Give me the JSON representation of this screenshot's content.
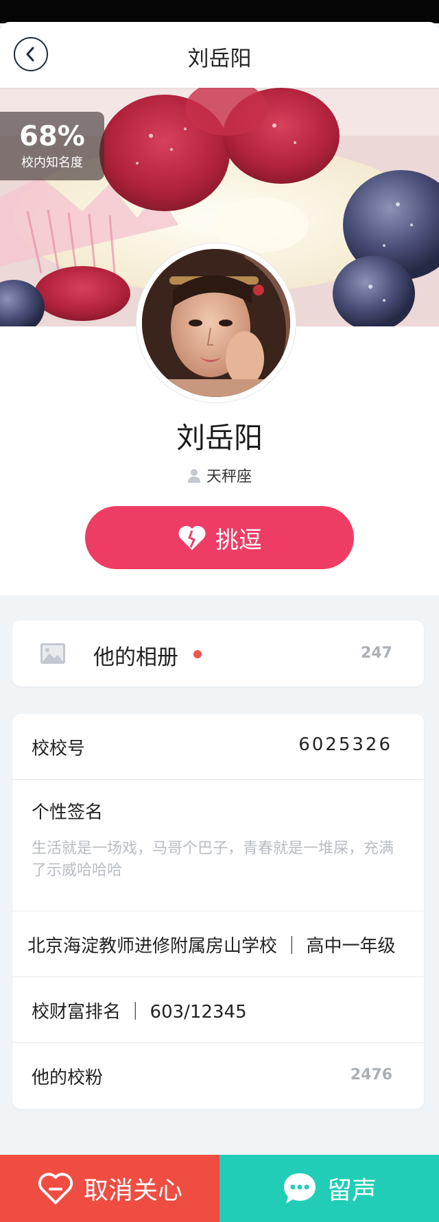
{
  "nav": {
    "title": "刘岳阳"
  },
  "cover": {
    "popularity_percent": "68%",
    "popularity_label": "校内知名度"
  },
  "profile": {
    "name": "刘岳阳",
    "zodiac": "天秤座",
    "flirt_label": "挑逗"
  },
  "album": {
    "title": "他的相册",
    "count": "247"
  },
  "info": {
    "school_id_label": "校校号",
    "school_id_value": "6025326",
    "signature_label": "个性签名",
    "signature_text": "生活就是一场戏，马哥个巴子，青春就是一堆屎，充满了示威哈哈哈",
    "school_grade": "北京海淀教师进修附属房山学校 ｜ 高中一年级",
    "wealth_rank": "校财富排名 ｜ 603/12345",
    "fans_label": "他的校粉",
    "fans_count": "2476"
  },
  "bottom": {
    "unfollow_label": "取消关心",
    "message_label": "留声"
  },
  "colors": {
    "flirt": "#ee3d64",
    "unfollow": "#ef4d41",
    "message": "#22cdb7",
    "dot": "#f0554d"
  },
  "icons": [
    "back-icon",
    "person-icon",
    "heart-icon",
    "image-icon",
    "heart-minus-icon",
    "chat-bubble-icon"
  ]
}
